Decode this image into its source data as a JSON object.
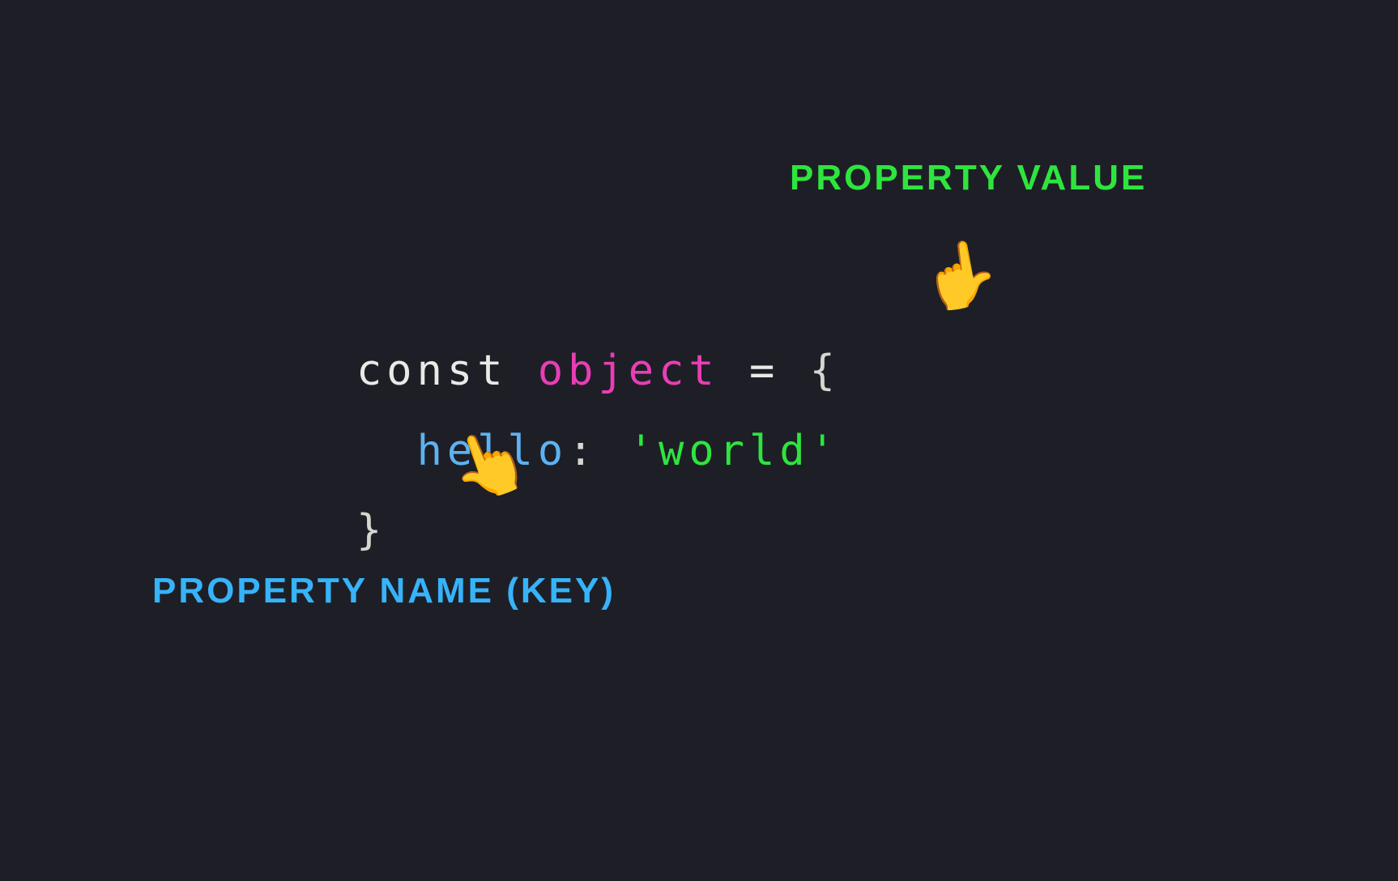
{
  "labels": {
    "value": "PROPERTY VALUE",
    "key": "PROPERTY NAME (KEY)"
  },
  "code": {
    "keyword": "const ",
    "ident": "object",
    "equals": " = ",
    "brace_open": "{",
    "indent": "  ",
    "prop": "hello",
    "colon": ": ",
    "string": "'world'",
    "brace_close": "}"
  },
  "icons": {
    "pointer_value": "👈",
    "pointer_key": "👆"
  }
}
